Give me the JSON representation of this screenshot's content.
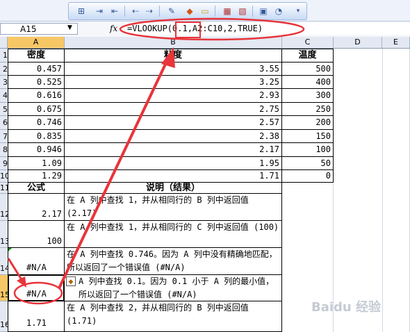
{
  "formula_bar": {
    "name_box": "A15",
    "fx_label": "fx",
    "formula": "=VLOOKUP(0.1,A2:C10,2,TRUE)"
  },
  "columns": [
    "A",
    "B",
    "C",
    "D",
    "E"
  ],
  "rows": [
    "1",
    "2",
    "3",
    "4",
    "5",
    "6",
    "7",
    "8",
    "9",
    "10",
    "11",
    "12",
    "13",
    "14",
    "15",
    "16"
  ],
  "table": {
    "headers": {
      "density": "密度",
      "viscosity": "粘度",
      "temperature": "温度"
    },
    "rows": [
      {
        "density": "0.457",
        "viscosity": "3.55",
        "temperature": "500"
      },
      {
        "density": "0.525",
        "viscosity": "3.25",
        "temperature": "400"
      },
      {
        "density": "0.616",
        "viscosity": "2.93",
        "temperature": "300"
      },
      {
        "density": "0.675",
        "viscosity": "2.75",
        "temperature": "250"
      },
      {
        "density": "0.746",
        "viscosity": "2.57",
        "temperature": "200"
      },
      {
        "density": "0.835",
        "viscosity": "2.38",
        "temperature": "150"
      },
      {
        "density": "0.946",
        "viscosity": "2.17",
        "temperature": "100"
      },
      {
        "density": "1.09",
        "viscosity": "1.95",
        "temperature": "50"
      },
      {
        "density": "1.29",
        "viscosity": "1.71",
        "temperature": "0"
      }
    ]
  },
  "examples": {
    "header_formula": "公式",
    "header_desc": "说明（结果）",
    "rows": [
      {
        "result": "2.17",
        "desc": "在 A 列中查找 1，并从相同行的 B 列中返回值 (2.17)"
      },
      {
        "result": "100",
        "desc": "在 A 列中查找 1，并从相同行的 C 列中返回值 (100)"
      },
      {
        "result": "#N/A",
        "desc": "在 A 列中查找 0.746。因为 A 列中没有精确地匹配，所以返回了一个错误值 (#N/A)"
      },
      {
        "result": "#N/A",
        "desc": "A 列中查找 0.1。因为 0.1 小于 A 列的最小值，所以返回了一个错误值 (#N/A)"
      },
      {
        "result": "1.71",
        "desc": "在 A 列中查找 2，并从相同行的 B 列中返回值 (1.71)"
      }
    ]
  },
  "watermark": "Baidu 经验",
  "colors": {
    "annotation": "#e8343a",
    "selected_header": "#f7c766"
  }
}
